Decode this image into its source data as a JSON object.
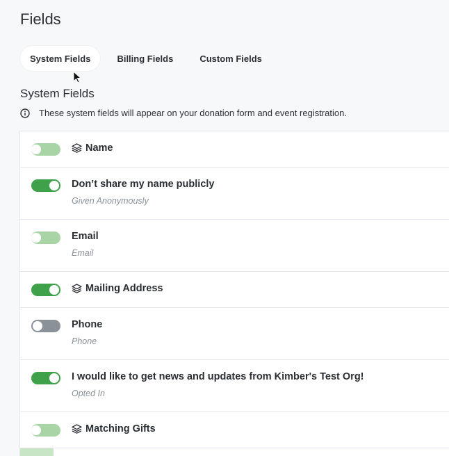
{
  "page": {
    "title": "Fields"
  },
  "tabs": [
    {
      "label": "System Fields",
      "active": true
    },
    {
      "label": "Billing Fields",
      "active": false
    },
    {
      "label": "Custom Fields",
      "active": false
    }
  ],
  "section": {
    "title": "System Fields",
    "info": "These system fields will appear on your donation form and event registration."
  },
  "fields": [
    {
      "label": "Name",
      "sublabel": "",
      "state": "on-disabled",
      "layers_icon": true
    },
    {
      "label": "Don’t share my name publicly",
      "sublabel": "Given Anonymously",
      "state": "on",
      "layers_icon": false
    },
    {
      "label": "Email",
      "sublabel": "Email",
      "state": "on-disabled",
      "layers_icon": false
    },
    {
      "label": "Mailing Address",
      "sublabel": "",
      "state": "on",
      "layers_icon": true
    },
    {
      "label": "Phone",
      "sublabel": "Phone",
      "state": "off",
      "layers_icon": false
    },
    {
      "label": "I would like to get news and updates from Kimber's Test Org!",
      "sublabel": "Opted In",
      "state": "on",
      "layers_icon": false
    },
    {
      "label": "Matching Gifts",
      "sublabel": "",
      "state": "on-disabled",
      "layers_icon": true
    }
  ],
  "colors": {
    "toggle_on": "#3fa24a",
    "toggle_on_disabled": "#a9d4a6",
    "toggle_off": "#8a9198",
    "background": "#f7f8fa"
  }
}
